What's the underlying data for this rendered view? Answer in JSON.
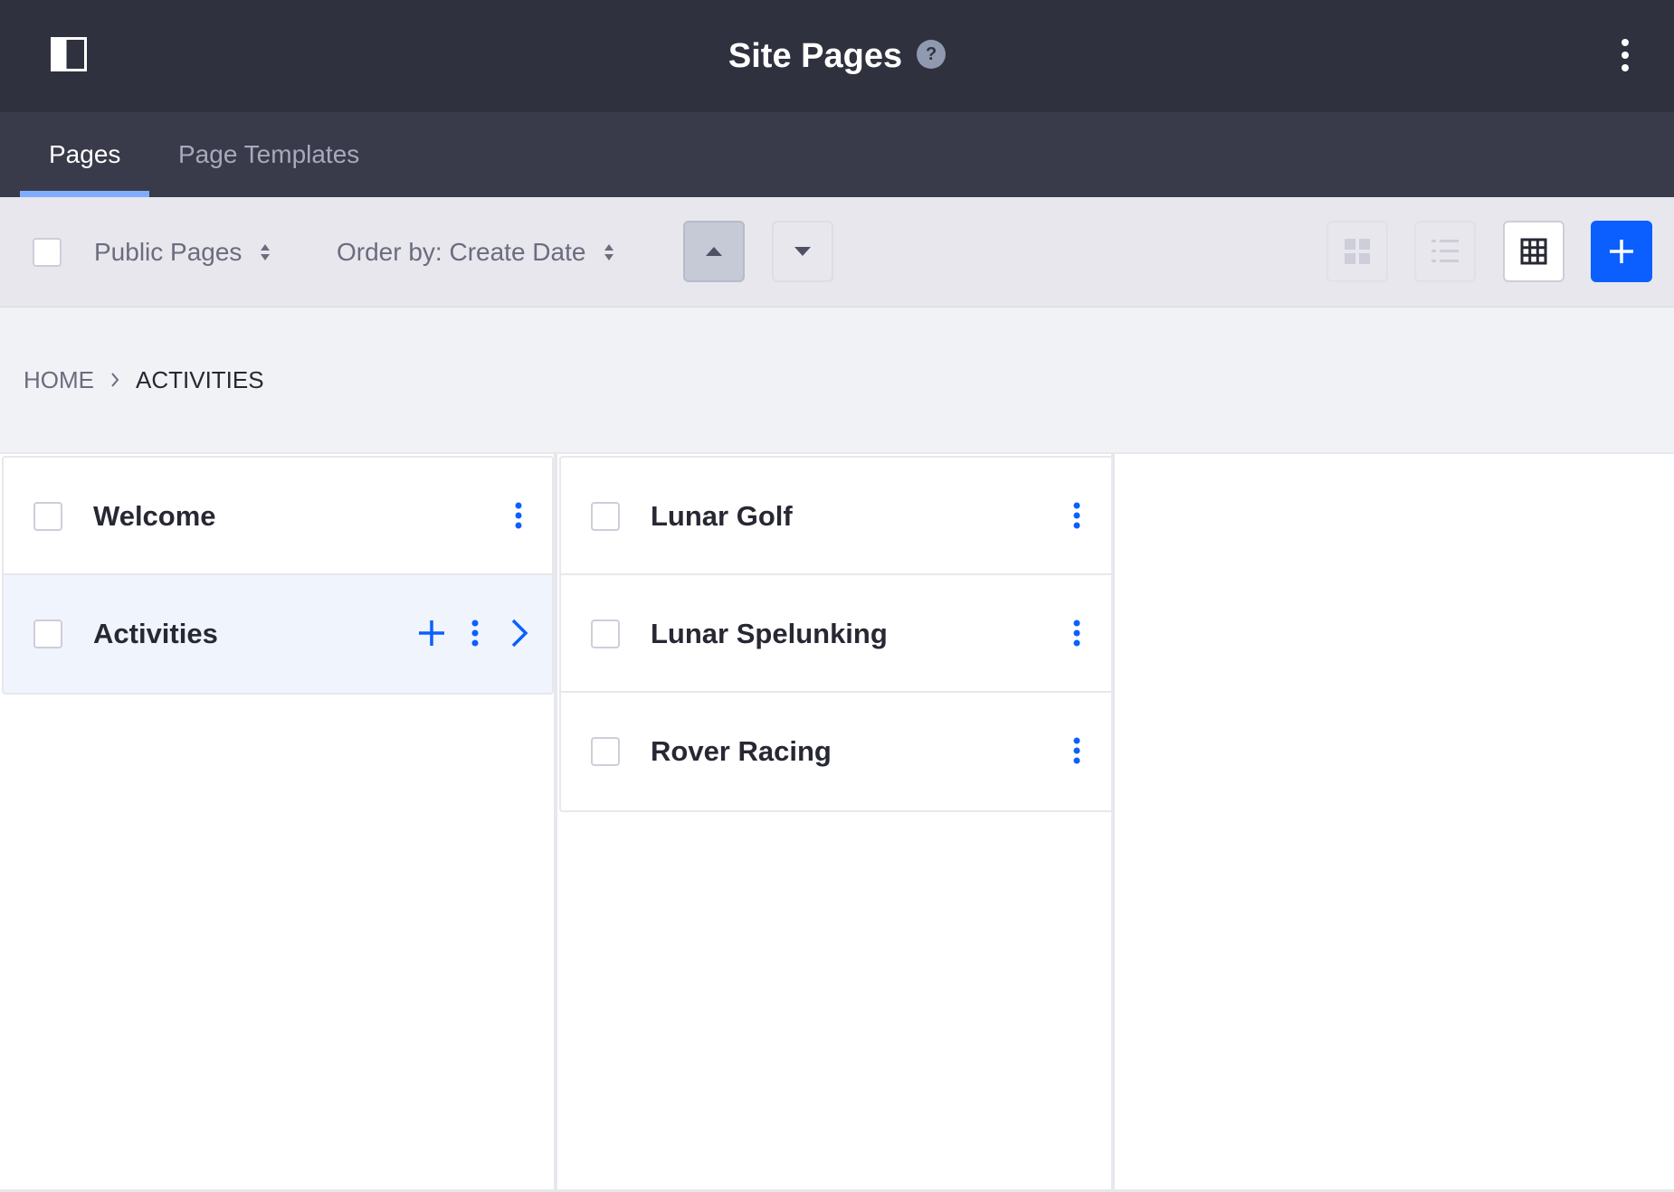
{
  "header": {
    "title": "Site Pages",
    "help_icon": "question-circle-icon",
    "sidebar_icon": "sidebar-toggle-icon",
    "options_icon": "vertical-ellipsis-icon",
    "help_glyph": "?"
  },
  "tabs": [
    {
      "label": "Pages",
      "active": true
    },
    {
      "label": "Page Templates",
      "active": false
    }
  ],
  "toolbar": {
    "page_type": "Public Pages",
    "order_by": "Order by: Create Date",
    "sort_ascending_icon": "caret-top-icon",
    "sort_descending_icon": "caret-bottom-icon",
    "view_modes": [
      "cards-icon",
      "list-icon",
      "table-grid-icon"
    ],
    "active_view": "table-grid-icon",
    "add_icon": "plus-icon"
  },
  "breadcrumb": {
    "items": [
      "HOME",
      "ACTIVITIES"
    ],
    "separator_icon": "angle-right-icon"
  },
  "columns": [
    {
      "items": [
        {
          "label": "Welcome",
          "active": false
        },
        {
          "label": "Activities",
          "active": true,
          "actions": [
            "plus-icon",
            "vertical-ellipsis-icon",
            "angle-right-icon"
          ]
        }
      ]
    },
    {
      "items": [
        {
          "label": "Lunar Golf"
        },
        {
          "label": "Lunar Spelunking"
        },
        {
          "label": "Rover Racing"
        }
      ]
    },
    {
      "items": []
    }
  ],
  "colors": {
    "header_bg": "#30313f",
    "tabbar_bg": "#393a4a",
    "tab_underline": "#80acff",
    "primary": "#0b5fff",
    "toolbar_bg": "#e7e7ed",
    "active_item_bg": "#eff4fd"
  }
}
